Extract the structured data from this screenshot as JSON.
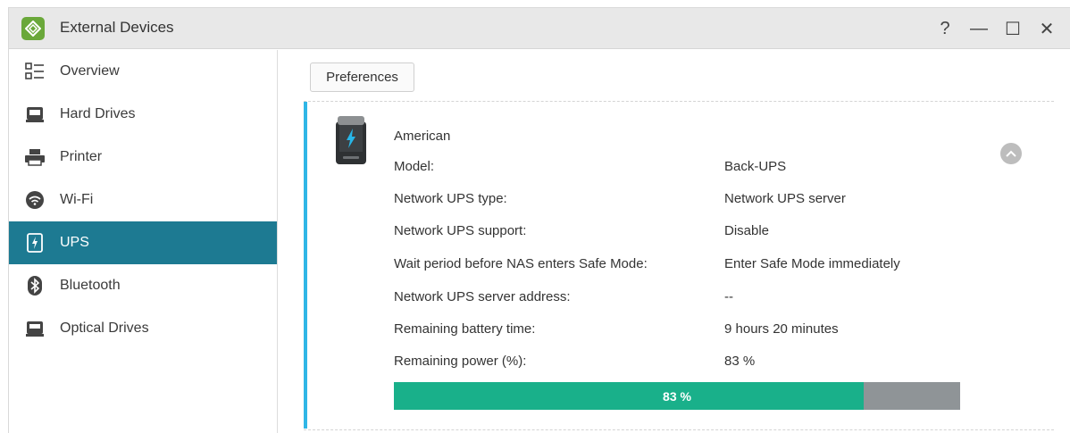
{
  "window": {
    "title": "External Devices",
    "controls": {
      "help": "?",
      "minimize": "—",
      "maximize": "☐",
      "close": "✕"
    }
  },
  "sidebar": {
    "items": [
      {
        "label": "Overview",
        "icon": "overview-icon"
      },
      {
        "label": "Hard Drives",
        "icon": "hard-drive-icon"
      },
      {
        "label": "Printer",
        "icon": "printer-icon"
      },
      {
        "label": "Wi-Fi",
        "icon": "wifi-icon"
      },
      {
        "label": "UPS",
        "icon": "ups-icon",
        "active": true
      },
      {
        "label": "Bluetooth",
        "icon": "bluetooth-icon"
      },
      {
        "label": "Optical Drives",
        "icon": "optical-drive-icon"
      }
    ]
  },
  "toolbar": {
    "preferences_label": "Preferences"
  },
  "ups": {
    "brand": "American",
    "rows": [
      {
        "label": "Model:",
        "value": "Back-UPS"
      },
      {
        "label": "Network UPS type:",
        "value": "Network UPS server"
      },
      {
        "label": "Network UPS support:",
        "value": "Disable"
      },
      {
        "label": "Wait period before NAS enters Safe Mode:",
        "value": "Enter Safe Mode immediately"
      },
      {
        "label": "Network UPS server address:",
        "value": "--"
      },
      {
        "label": "Remaining battery time:",
        "value": "9 hours 20 minutes"
      },
      {
        "label": "Remaining power (%):",
        "value": "83 %"
      }
    ],
    "power_percent": 83,
    "power_bar_label": "83 %"
  },
  "colors": {
    "accent": "#1d7a92",
    "card_accent": "#2fb6e6",
    "progress_fill": "#19b08a",
    "progress_track": "#8f9497"
  }
}
